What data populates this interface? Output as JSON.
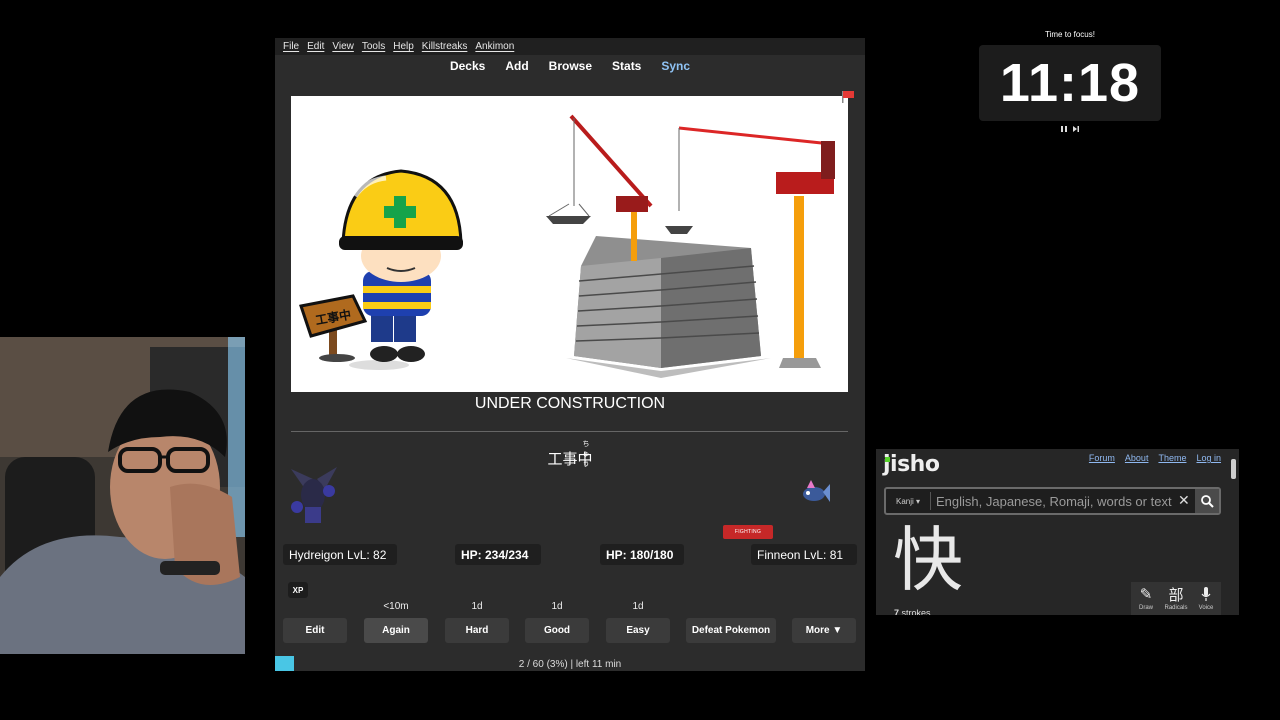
{
  "anki": {
    "menu": [
      "File",
      "Edit",
      "View",
      "Tools",
      "Help",
      "Killstreaks",
      "Ankimon"
    ],
    "toplinks": [
      "Decks",
      "Add",
      "Browse",
      "Stats",
      "Sync"
    ],
    "card": {
      "image_sign_text": "工事中",
      "title": "UNDER CONSTRUCTION",
      "answer_kanji": "工事中",
      "answer_furigana": "ちゅう"
    },
    "battle": {
      "player_name_level": "Hydreigon LvL: 82",
      "player_hp": "HP: 234/234",
      "enemy_hp": "HP: 180/180",
      "enemy_name_level": "Finneon LvL: 81",
      "enemy_type_badge": "FIGHTING",
      "xp_badge": "XP"
    },
    "intervals": [
      "<10m",
      "1d",
      "1d",
      "1d"
    ],
    "buttons": {
      "edit": "Edit",
      "again": "Again",
      "hard": "Hard",
      "good": "Good",
      "easy": "Easy",
      "defeat": "Defeat Pokemon",
      "more": "More ▼"
    },
    "progress_text": "2 / 60 (3%) | left 11 min",
    "progress_color": "#49c6e5"
  },
  "focus_timer": {
    "label": "Time to focus!",
    "time": "11:18",
    "pause_icon": "pause-icon",
    "skip_icon": "skip-icon"
  },
  "jisho": {
    "logo": "jisho",
    "links": [
      "Forum",
      "About",
      "Theme",
      "Log in"
    ],
    "search_mode": "Kanji ▾",
    "search_placeholder": "English, Japanese, Romaji, words or text",
    "kanji": "快",
    "strokes_num": "7",
    "strokes_word": "strokes",
    "tools": [
      "Draw",
      "Radicals",
      "Voice"
    ]
  }
}
